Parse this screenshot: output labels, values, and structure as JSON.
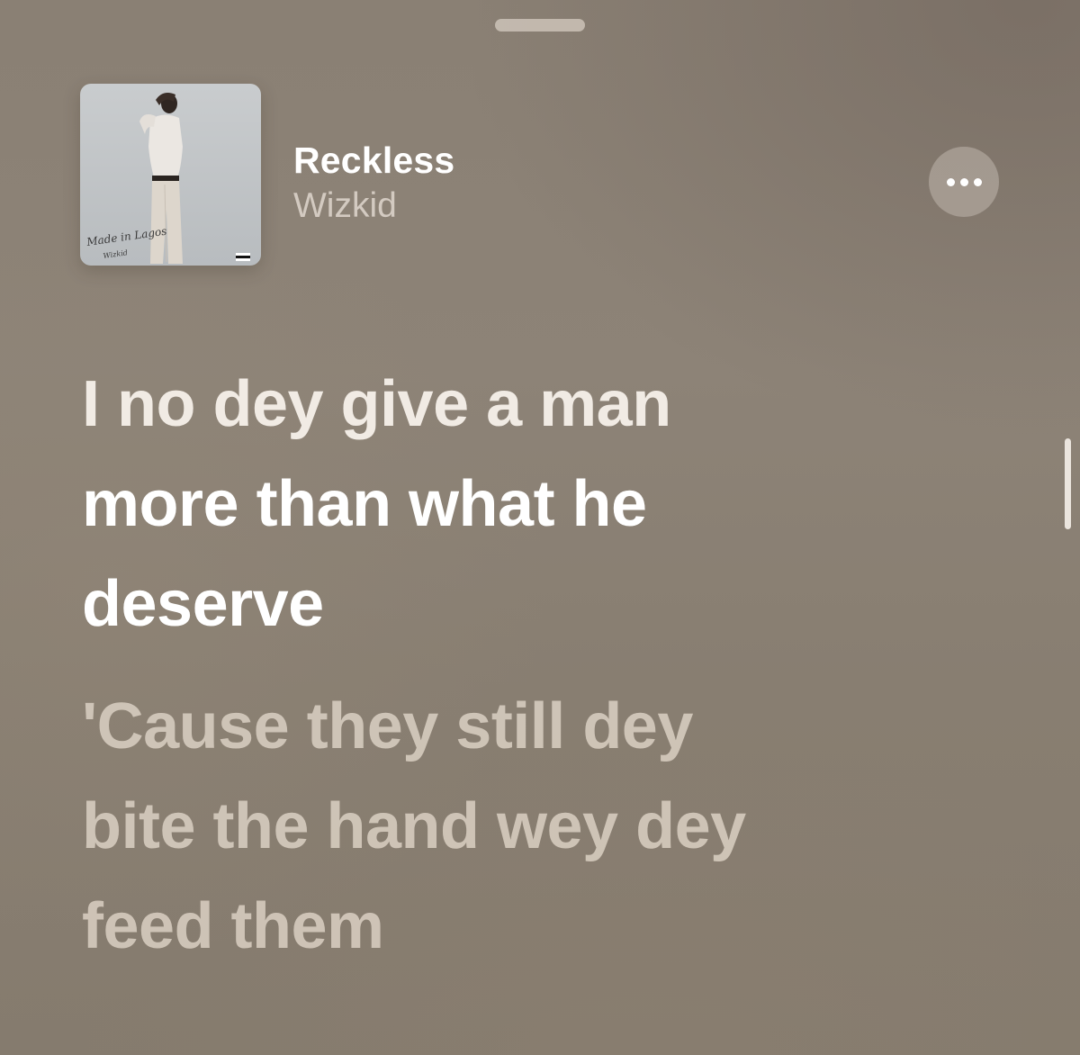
{
  "now_playing": {
    "title": "Reckless",
    "artist": "Wizkid",
    "album_art": {
      "caption": "Made in Lagos",
      "signature": "Wizkid"
    }
  },
  "lyrics": {
    "current": [
      "I no dey give a man",
      "more than what he",
      "deserve"
    ],
    "next": [
      "'Cause they still dey",
      "bite the hand wey dey",
      "feed them"
    ]
  },
  "icons": {
    "more": "more-horizontal-icon",
    "grabber": "sheet-grabber"
  }
}
